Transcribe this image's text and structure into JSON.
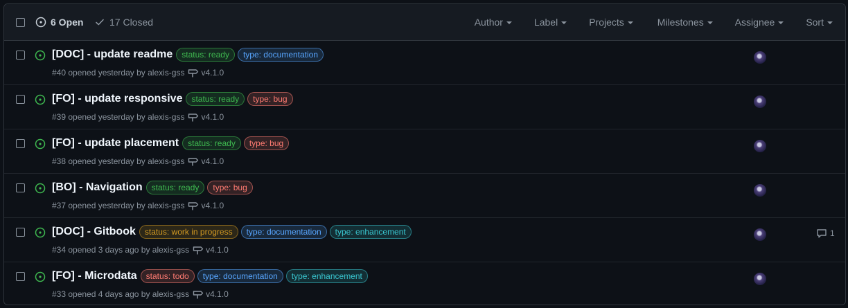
{
  "header": {
    "open_count": "6 Open",
    "closed_count": "17 Closed",
    "filters": [
      "Author",
      "Label",
      "Projects",
      "Milestones",
      "Assignee",
      "Sort"
    ]
  },
  "issues": [
    {
      "title": "[DOC] - update readme",
      "labels": [
        {
          "text": "status: ready",
          "color": "#3fb950"
        },
        {
          "text": "type: documentation",
          "color": "#58a6ff"
        }
      ],
      "meta": "#40 opened yesterday by alexis-gss",
      "milestone": "v4.1.0",
      "comments": ""
    },
    {
      "title": "[FO] - update responsive",
      "labels": [
        {
          "text": "status: ready",
          "color": "#3fb950"
        },
        {
          "text": "type: bug",
          "color": "#ff7b72"
        }
      ],
      "meta": "#39 opened yesterday by alexis-gss",
      "milestone": "v4.1.0",
      "comments": ""
    },
    {
      "title": "[FO] - update placement",
      "labels": [
        {
          "text": "status: ready",
          "color": "#3fb950"
        },
        {
          "text": "type: bug",
          "color": "#ff7b72"
        }
      ],
      "meta": "#38 opened yesterday by alexis-gss",
      "milestone": "v4.1.0",
      "comments": ""
    },
    {
      "title": "[BO] - Navigation",
      "labels": [
        {
          "text": "status: ready",
          "color": "#3fb950"
        },
        {
          "text": "type: bug",
          "color": "#ff7b72"
        }
      ],
      "meta": "#37 opened yesterday by alexis-gss",
      "milestone": "v4.1.0",
      "comments": ""
    },
    {
      "title": "[DOC] - Gitbook",
      "labels": [
        {
          "text": "status: work in progress",
          "color": "#d29922"
        },
        {
          "text": "type: documentation",
          "color": "#58a6ff"
        },
        {
          "text": "type: enhancement",
          "color": "#39c5cf"
        }
      ],
      "meta": "#34 opened 3 days ago by alexis-gss",
      "milestone": "v4.1.0",
      "comments": "1"
    },
    {
      "title": "[FO] - Microdata",
      "labels": [
        {
          "text": "status: todo",
          "color": "#ff7b72"
        },
        {
          "text": "type: documentation",
          "color": "#58a6ff"
        },
        {
          "text": "type: enhancement",
          "color": "#39c5cf"
        }
      ],
      "meta": "#33 opened 4 days ago by alexis-gss",
      "milestone": "v4.1.0",
      "comments": ""
    }
  ]
}
